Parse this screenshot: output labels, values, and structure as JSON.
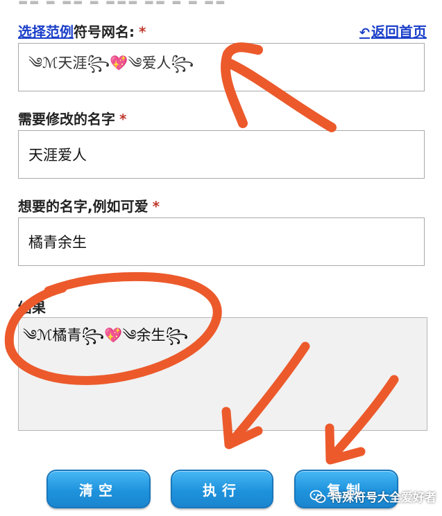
{
  "form": {
    "example_link": "选择范例",
    "example_label": "符号网名:",
    "required_mark": "*",
    "home_arrow": "↶",
    "home_link": "返回首页",
    "example_value": "༄ℳ天涯꧂💖༄爱人꧂",
    "original_label": "需要修改的名字",
    "original_value": "天涯爱人",
    "target_label": "想要的名字,例如可爱",
    "target_value": "橘青余生",
    "result_label": "结果",
    "result_value": "༄ℳ橘青꧂💖༄余生꧂"
  },
  "buttons": {
    "clear": "清空",
    "execute": "执行",
    "copy": "复制"
  },
  "watermark": {
    "text": "特殊符号大全爱好者"
  },
  "colors": {
    "link": "#1a3ec9",
    "required": "#c0392b",
    "button": "#1f93dd",
    "annotation": "#ec5a2c"
  }
}
